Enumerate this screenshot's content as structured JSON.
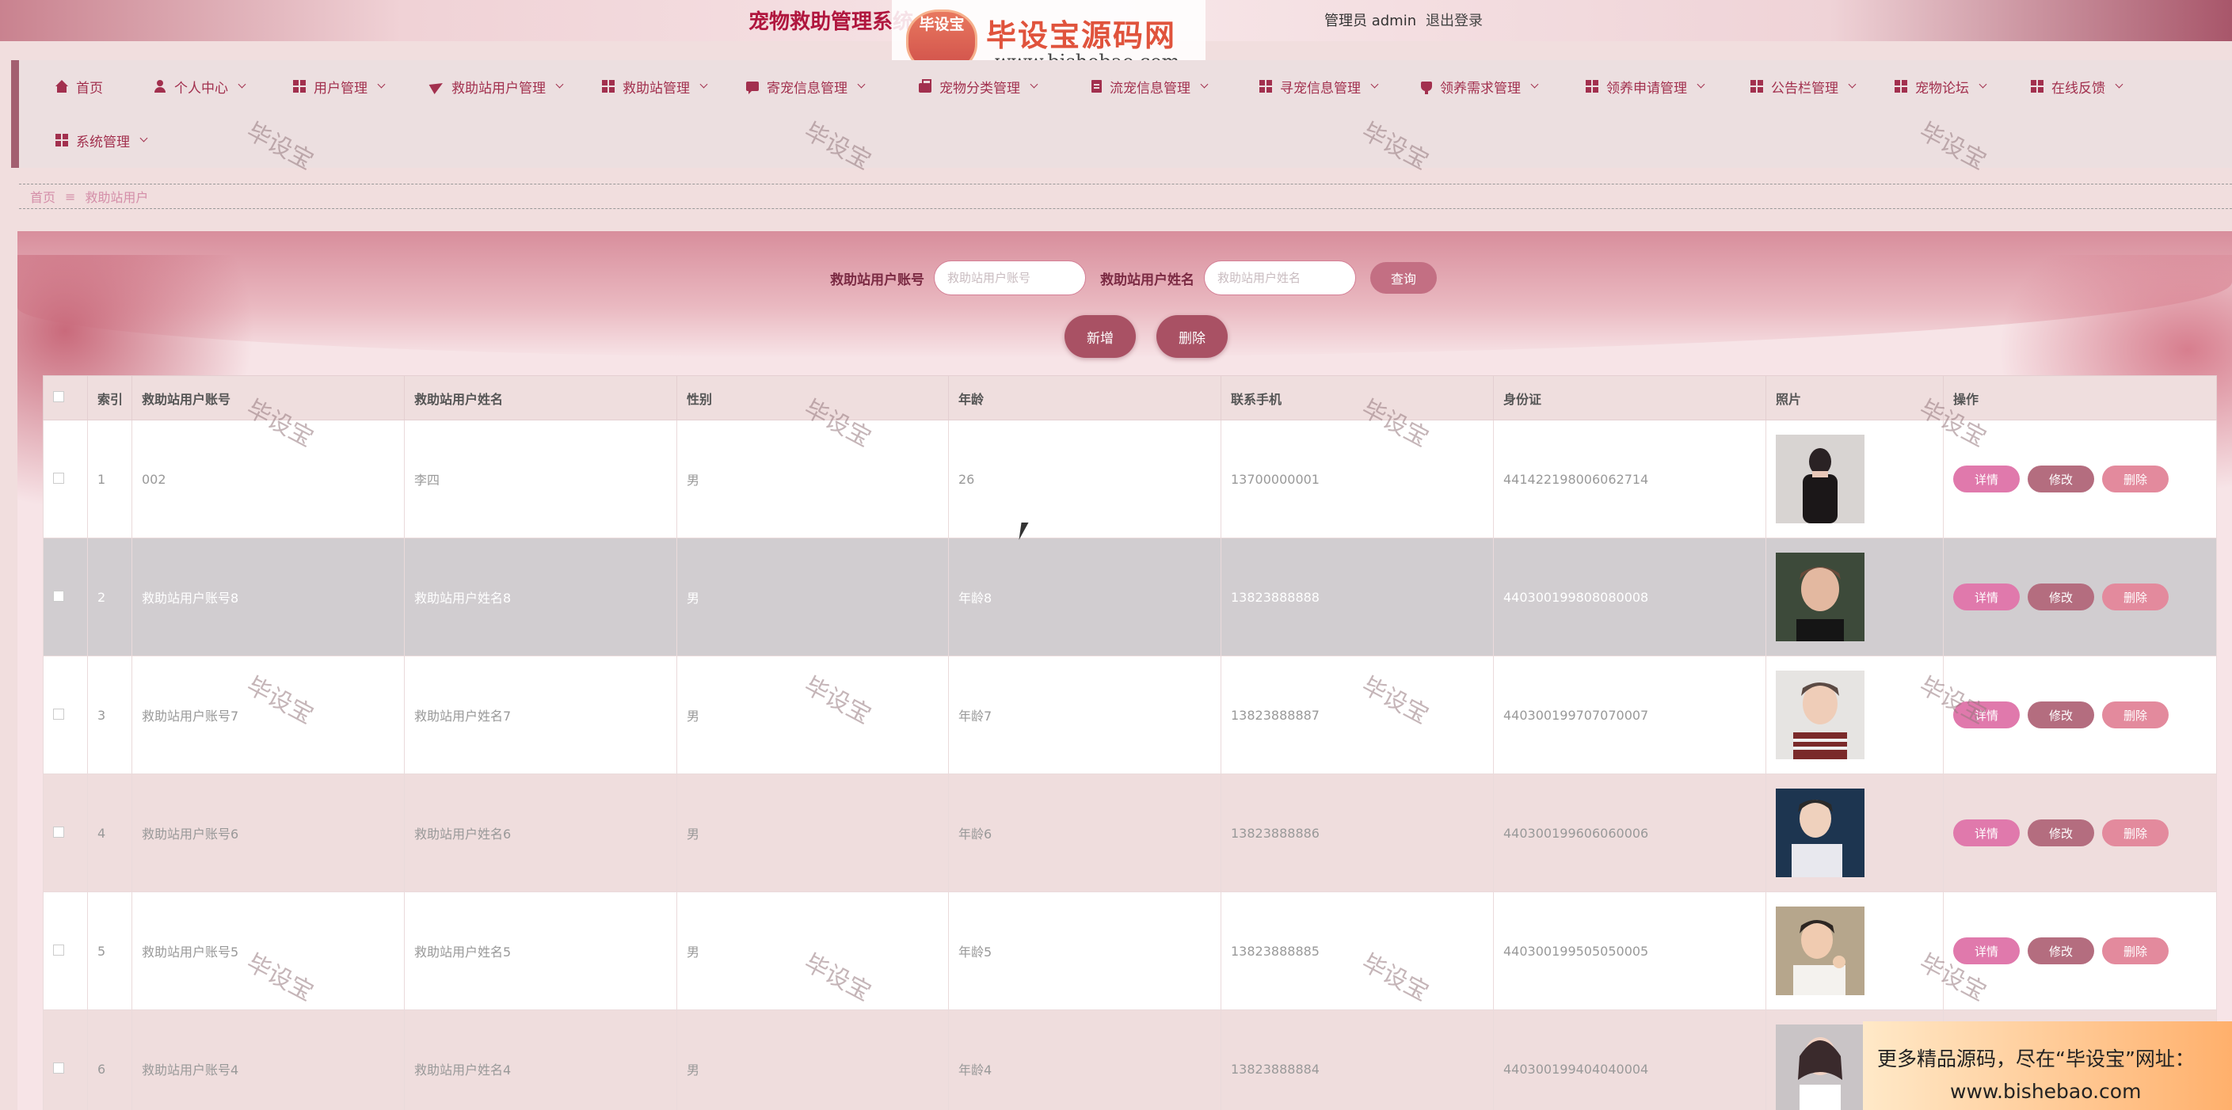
{
  "header": {
    "title": "宠物救助管理系统",
    "user_info": "管理员 admin",
    "logout": "退出登录"
  },
  "logo": {
    "badge": "毕设宝",
    "name": "毕设宝源码网",
    "url": "www.bishebao.com"
  },
  "nav": {
    "items": [
      {
        "label": "首页",
        "icon": "home-icon"
      },
      {
        "label": "个人中心",
        "icon": "user-icon"
      },
      {
        "label": "用户管理",
        "icon": "grid-icon"
      },
      {
        "label": "救助站用户管理",
        "icon": "paper-plane-icon"
      },
      {
        "label": "救助站管理",
        "icon": "grid-icon"
      },
      {
        "label": "寄宠信息管理",
        "icon": "message-icon"
      },
      {
        "label": "宠物分类管理",
        "icon": "briefcase-icon"
      },
      {
        "label": "流宠信息管理",
        "icon": "document-icon"
      },
      {
        "label": "寻宠信息管理",
        "icon": "grid-icon"
      },
      {
        "label": "领养需求管理",
        "icon": "cup-icon"
      },
      {
        "label": "领养申请管理",
        "icon": "grid-icon"
      },
      {
        "label": "公告栏管理",
        "icon": "grid-icon"
      },
      {
        "label": "宠物论坛",
        "icon": "grid-icon"
      },
      {
        "label": "在线反馈",
        "icon": "grid-icon"
      },
      {
        "label": "系统管理",
        "icon": "grid-icon"
      }
    ]
  },
  "breadcrumb": {
    "home": "首页",
    "separator": "≡",
    "current": "救助站用户"
  },
  "search": {
    "account_label": "救助站用户账号",
    "account_placeholder": "救助站用户账号",
    "name_label": "救助站用户姓名",
    "name_placeholder": "救助站用户姓名",
    "query_button": "查询"
  },
  "actions": {
    "add": "新增",
    "delete": "删除"
  },
  "table": {
    "columns": [
      "索引",
      "救助站用户账号",
      "救助站用户姓名",
      "性别",
      "年龄",
      "联系手机",
      "身份证",
      "照片",
      "操作"
    ],
    "row_buttons": {
      "detail": "详情",
      "edit": "修改",
      "delete": "删除"
    },
    "rows": [
      {
        "index": "1",
        "account": "002",
        "name": "李四",
        "gender": "男",
        "age": "26",
        "phone": "13700000001",
        "id_card": "441422198006062714"
      },
      {
        "index": "2",
        "account": "救助站用户账号8",
        "name": "救助站用户姓名8",
        "gender": "男",
        "age": "年龄8",
        "phone": "13823888888",
        "id_card": "440300199808080008"
      },
      {
        "index": "3",
        "account": "救助站用户账号7",
        "name": "救助站用户姓名7",
        "gender": "男",
        "age": "年龄7",
        "phone": "13823888887",
        "id_card": "440300199707070007"
      },
      {
        "index": "4",
        "account": "救助站用户账号6",
        "name": "救助站用户姓名6",
        "gender": "男",
        "age": "年龄6",
        "phone": "13823888886",
        "id_card": "440300199606060006"
      },
      {
        "index": "5",
        "account": "救助站用户账号5",
        "name": "救助站用户姓名5",
        "gender": "男",
        "age": "年龄5",
        "phone": "13823888885",
        "id_card": "440300199505050005"
      },
      {
        "index": "6",
        "account": "救助站用户账号4",
        "name": "救助站用户姓名4",
        "gender": "男",
        "age": "年龄4",
        "phone": "13823888884",
        "id_card": "440300199404040004"
      }
    ]
  },
  "watermark": "毕设宝",
  "ad": {
    "line1": "更多精品源码，尽在“毕设宝”网址：",
    "line2": "www.bishebao.com"
  },
  "colors": {
    "accent": "#a2304e",
    "title": "#b0163e",
    "detail_button": "#e079ac",
    "edit_button": "#b46d7f",
    "delete_button": "#e38a9d"
  }
}
